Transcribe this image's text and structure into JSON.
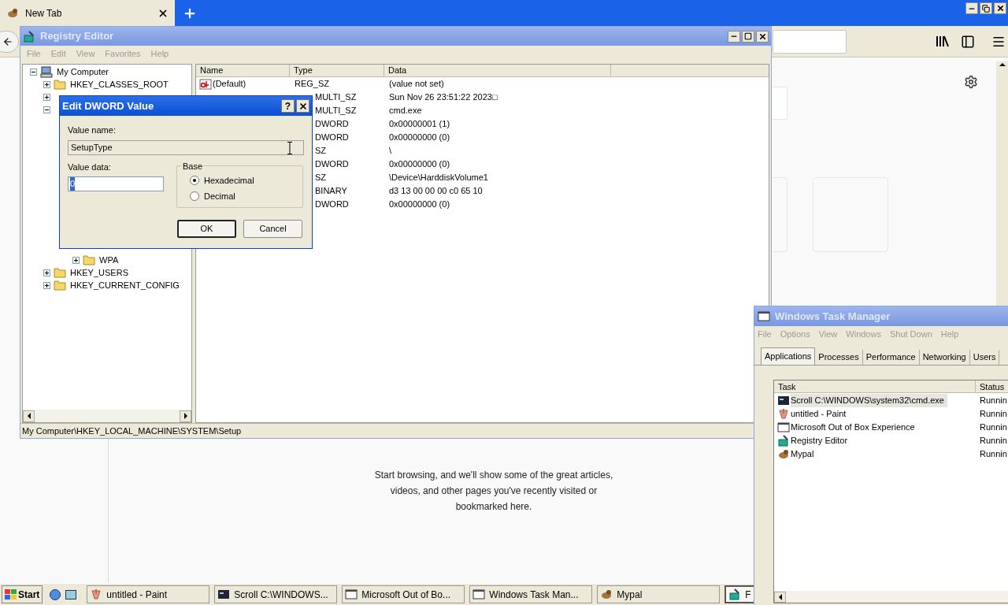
{
  "browser": {
    "tab_title": "New Tab",
    "empty_message": "Start browsing, and we'll show some of the great articles, videos, and other pages you've recently visited or bookmarked here."
  },
  "registry_editor": {
    "title": "Registry Editor",
    "menu": [
      "File",
      "Edit",
      "View",
      "Favorites",
      "Help"
    ],
    "tree": {
      "root": {
        "label": "My Computer",
        "expanded": true
      },
      "top_items": [
        {
          "label": "HKEY_CLASSES_ROOT",
          "expanded": false
        },
        {
          "expanded": false
        },
        {
          "expanded": true
        }
      ],
      "nested_items": [
        {
          "label": "WPA",
          "expanded": false
        }
      ],
      "bottom_items": [
        {
          "label": "HKEY_USERS",
          "expanded": false
        },
        {
          "label": "HKEY_CURRENT_CONFIG",
          "expanded": false
        }
      ]
    },
    "columns": [
      "Name",
      "Type",
      "Data"
    ],
    "rows": [
      {
        "name": "(Default)",
        "type": "REG_SZ",
        "data": "(value not set)"
      },
      {
        "type": "MULTI_SZ",
        "data": "Sun Nov 26 23:51:22 2023□"
      },
      {
        "type": "MULTI_SZ",
        "data": "cmd.exe"
      },
      {
        "type": "DWORD",
        "data": "0x00000001 (1)"
      },
      {
        "type": "DWORD",
        "data": "0x00000000 (0)"
      },
      {
        "type": "SZ",
        "data": "\\"
      },
      {
        "type": "DWORD",
        "data": "0x00000000 (0)"
      },
      {
        "type": "SZ",
        "data": "\\Device\\HarddiskVolume1"
      },
      {
        "type": "BINARY",
        "data": "d3 13 00 00 00 c0 65 10"
      },
      {
        "type": "DWORD",
        "data": "0x00000000 (0)"
      }
    ],
    "status_bar": "My Computer\\HKEY_LOCAL_MACHINE\\SYSTEM\\Setup"
  },
  "dialog": {
    "title": "Edit DWORD Value",
    "help": "?",
    "value_name_label": "Value name:",
    "value_name": "SetupType",
    "value_data_label": "Value data:",
    "value_data": "0",
    "base": {
      "label": "Base",
      "options": [
        {
          "label": "Hexadecimal",
          "selected": true
        },
        {
          "label": "Decimal",
          "selected": false
        }
      ]
    },
    "buttons": [
      "OK",
      "Cancel"
    ]
  },
  "task_manager": {
    "title": "Windows Task Manager",
    "menu": [
      "File",
      "Options",
      "View",
      "Windows",
      "Shut Down",
      "Help"
    ],
    "tabs": [
      {
        "label": "Applications",
        "selected": true
      },
      {
        "label": "Processes",
        "selected": false
      },
      {
        "label": "Performance",
        "selected": false
      },
      {
        "label": "Networking",
        "selected": false
      },
      {
        "label": "Users",
        "selected": false
      }
    ],
    "columns": [
      "Task",
      "Status"
    ],
    "rows": [
      {
        "task": "Scroll C:\\WINDOWS\\system32\\cmd.exe",
        "status": "Runnin",
        "selected": true
      },
      {
        "task": "untitled - Paint",
        "status": "Runnin",
        "selected": false
      },
      {
        "task": "Microsoft Out of Box Experience",
        "status": "Runnin",
        "selected": false
      },
      {
        "task": "Registry Editor",
        "status": "Runnin",
        "selected": false
      },
      {
        "task": "Mypal",
        "status": "Runnin",
        "selected": false
      }
    ]
  },
  "taskbar": {
    "start": "Start",
    "buttons": [
      {
        "label": "untitled - Paint",
        "selected": false
      },
      {
        "label": "Scroll C:\\WINDOWS...",
        "selected": false
      },
      {
        "label": "Microsoft Out of Bo...",
        "selected": false
      },
      {
        "label": "Windows Task Man...",
        "selected": false
      },
      {
        "label": "Mypal",
        "selected": false
      },
      {
        "label": "F",
        "selected": true
      }
    ]
  }
}
